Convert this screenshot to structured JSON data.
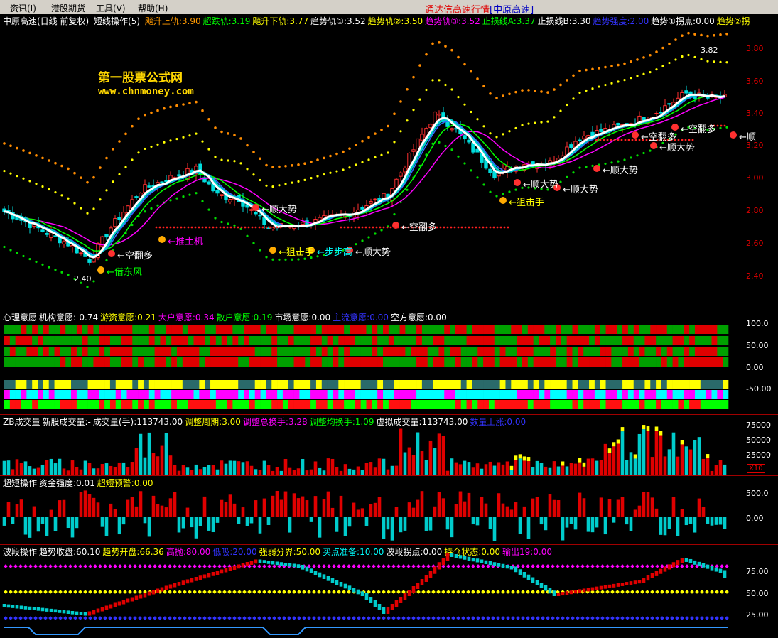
{
  "menu": {
    "items": [
      "资讯(I)",
      "港股期货",
      "工具(V)",
      "帮助(H)"
    ],
    "title": "通达信高速行情",
    "title_sub": "[中原高速]"
  },
  "main_panel": {
    "stock": "中原高速(日线 前复权)",
    "indicator": "短线操作(5)",
    "params": [
      {
        "text": "飚升上轨:3.90",
        "color": "#ff9900"
      },
      {
        "text": "超跌轨:3.19",
        "color": "#00ff00"
      },
      {
        "text": "飚升下轨:3.77",
        "color": "#ffff00"
      },
      {
        "text": "趋势轨①:3.52",
        "color": "#ffffff"
      },
      {
        "text": "趋势轨②:3.50",
        "color": "#ffff00"
      },
      {
        "text": "趋势轨③:3.52",
        "color": "#ff00ff"
      },
      {
        "text": "止损线A:3.37",
        "color": "#00ff00"
      },
      {
        "text": "止损线B:3.30",
        "color": "#ffffff"
      },
      {
        "text": "趋势强度:2.00",
        "color": "#3333ff"
      },
      {
        "text": "趋势①拐点:0.00",
        "color": "#ffffff"
      },
      {
        "text": "趋势②拐",
        "color": "#ffff00"
      }
    ],
    "y_axis": [
      "3.80",
      "3.60",
      "3.40",
      "3.20",
      "3.00",
      "2.80",
      "2.60",
      "2.40"
    ],
    "watermark_title": "第一股票公式网",
    "watermark_url": "www.chnmoney.com",
    "high_label": "3.82",
    "low_label": "2.40",
    "annotations": [
      {
        "text": "←空翻多",
        "color": "#ffffff"
      },
      {
        "text": "←借东风",
        "color": "#00ff00"
      },
      {
        "text": "←推土机",
        "color": "#ff00ff"
      },
      {
        "text": "←顺大势",
        "color": "#ffffff"
      },
      {
        "text": "←狙击手",
        "color": "#ffff00"
      },
      {
        "text": "←步步高",
        "color": "#00ffff"
      },
      {
        "text": "←顺大势",
        "color": "#ffffff"
      },
      {
        "text": "←空翻多",
        "color": "#ffffff"
      },
      {
        "text": "←狙击手",
        "color": "#ffff00"
      },
      {
        "text": "←顺大势",
        "color": "#ffffff"
      },
      {
        "text": "←顺大势",
        "color": "#ffffff"
      },
      {
        "text": "←顺大势",
        "color": "#ffffff"
      },
      {
        "text": "←空翻多",
        "color": "#ffffff"
      },
      {
        "text": "←顺大势",
        "color": "#ffffff"
      },
      {
        "text": "←空翻多",
        "color": "#ffffff"
      },
      {
        "text": "←顺",
        "color": "#ffffff"
      }
    ]
  },
  "mind_panel": {
    "params": [
      {
        "text": "心理意愿",
        "color": "#ffffff"
      },
      {
        "text": "机构意愿:-0.74",
        "color": "#ffffff"
      },
      {
        "text": "游资意愿:0.21",
        "color": "#ffff00"
      },
      {
        "text": "大户意愿:0.34",
        "color": "#ff00ff"
      },
      {
        "text": "散户意愿:0.19",
        "color": "#00ff00"
      },
      {
        "text": "市场意愿:0.00",
        "color": "#ffffff"
      },
      {
        "text": "主流意愿:0.00",
        "color": "#3333ff"
      },
      {
        "text": "空方意愿:0.00",
        "color": "#ffffff"
      }
    ],
    "y_axis": [
      "100.0",
      "50.00",
      "0.00",
      "-50.00"
    ]
  },
  "volume_panel": {
    "params": [
      {
        "text": "ZB成交量",
        "color": "#ffffff"
      },
      {
        "text": "新股成交量:-",
        "color": "#ffffff"
      },
      {
        "text": "成交量(手):113743.00",
        "color": "#ffffff"
      },
      {
        "text": "调整周期:3.00",
        "color": "#ffff00"
      },
      {
        "text": "调整总换手:3.28",
        "color": "#ff00ff"
      },
      {
        "text": "调整均换手:1.09",
        "color": "#00ff00"
      },
      {
        "text": "虚拟成交量:113743.00",
        "color": "#ffffff"
      },
      {
        "text": "数量上涨:0.00",
        "color": "#3333ff"
      }
    ],
    "y_axis": [
      "75000",
      "50000",
      "25000"
    ],
    "scale_label": "X10"
  },
  "ultra_panel": {
    "params": [
      {
        "text": "超短操作",
        "color": "#ffffff"
      },
      {
        "text": "资金强度:0.01",
        "color": "#ffffff"
      },
      {
        "text": "超短预警:0.00",
        "color": "#ffff00"
      }
    ],
    "y_axis": [
      "500.0",
      "0.00"
    ]
  },
  "wave_panel": {
    "params": [
      {
        "text": "波段操作",
        "color": "#ffffff"
      },
      {
        "text": "趋势收盘:60.10",
        "color": "#ffffff"
      },
      {
        "text": "趋势开盘:66.36",
        "color": "#ffff00"
      },
      {
        "text": "高抛:80.00",
        "color": "#ff00ff"
      },
      {
        "text": "低吸:20.00",
        "color": "#3333ff"
      },
      {
        "text": "强弱分界:50.00",
        "color": "#ffff00"
      },
      {
        "text": "买点准备:10.00",
        "color": "#00ffff"
      },
      {
        "text": "波段拐点:0.00",
        "color": "#ffffff"
      },
      {
        "text": "持仓状态:0.00",
        "color": "#ffff00"
      },
      {
        "text": "输出19:0.00",
        "color": "#ff00ff"
      }
    ],
    "y_axis": [
      "75.00",
      "50.00",
      "25.00"
    ]
  }
}
